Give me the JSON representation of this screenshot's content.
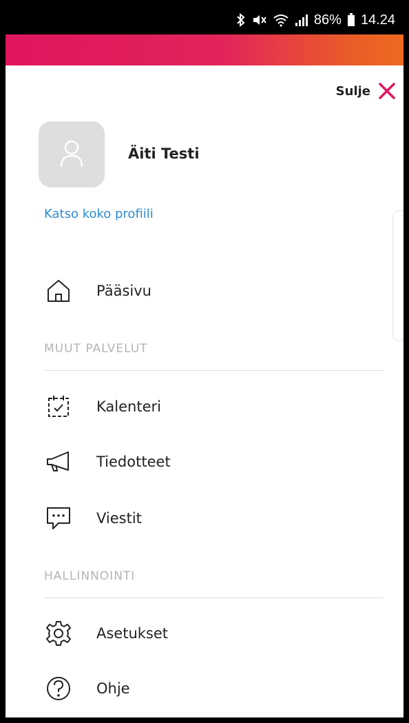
{
  "status_bar": {
    "battery": "86%",
    "time": "14.24",
    "icons": [
      "bluetooth-icon",
      "mute-icon",
      "wifi-icon",
      "signal-icon",
      "battery-icon"
    ]
  },
  "header": {
    "close_label": "Sulje",
    "close_icon": "close-icon",
    "accent_color": "#e0155f"
  },
  "profile": {
    "name": "Äiti Testi",
    "link_label": "Katso koko profiili",
    "avatar_icon": "user-icon"
  },
  "menu": {
    "home": {
      "label": "Pääsivu",
      "icon": "home-icon"
    },
    "section_other": "MUUT PALVELUT",
    "other_items": [
      {
        "label": "Kalenteri",
        "icon": "calendar-icon"
      },
      {
        "label": "Tiedotteet",
        "icon": "megaphone-icon"
      },
      {
        "label": "Viestit",
        "icon": "message-icon"
      }
    ],
    "section_admin": "HALLINNOINTI",
    "admin_items": [
      {
        "label": "Asetukset",
        "icon": "gear-icon"
      },
      {
        "label": "Ohje",
        "icon": "help-icon"
      }
    ]
  }
}
